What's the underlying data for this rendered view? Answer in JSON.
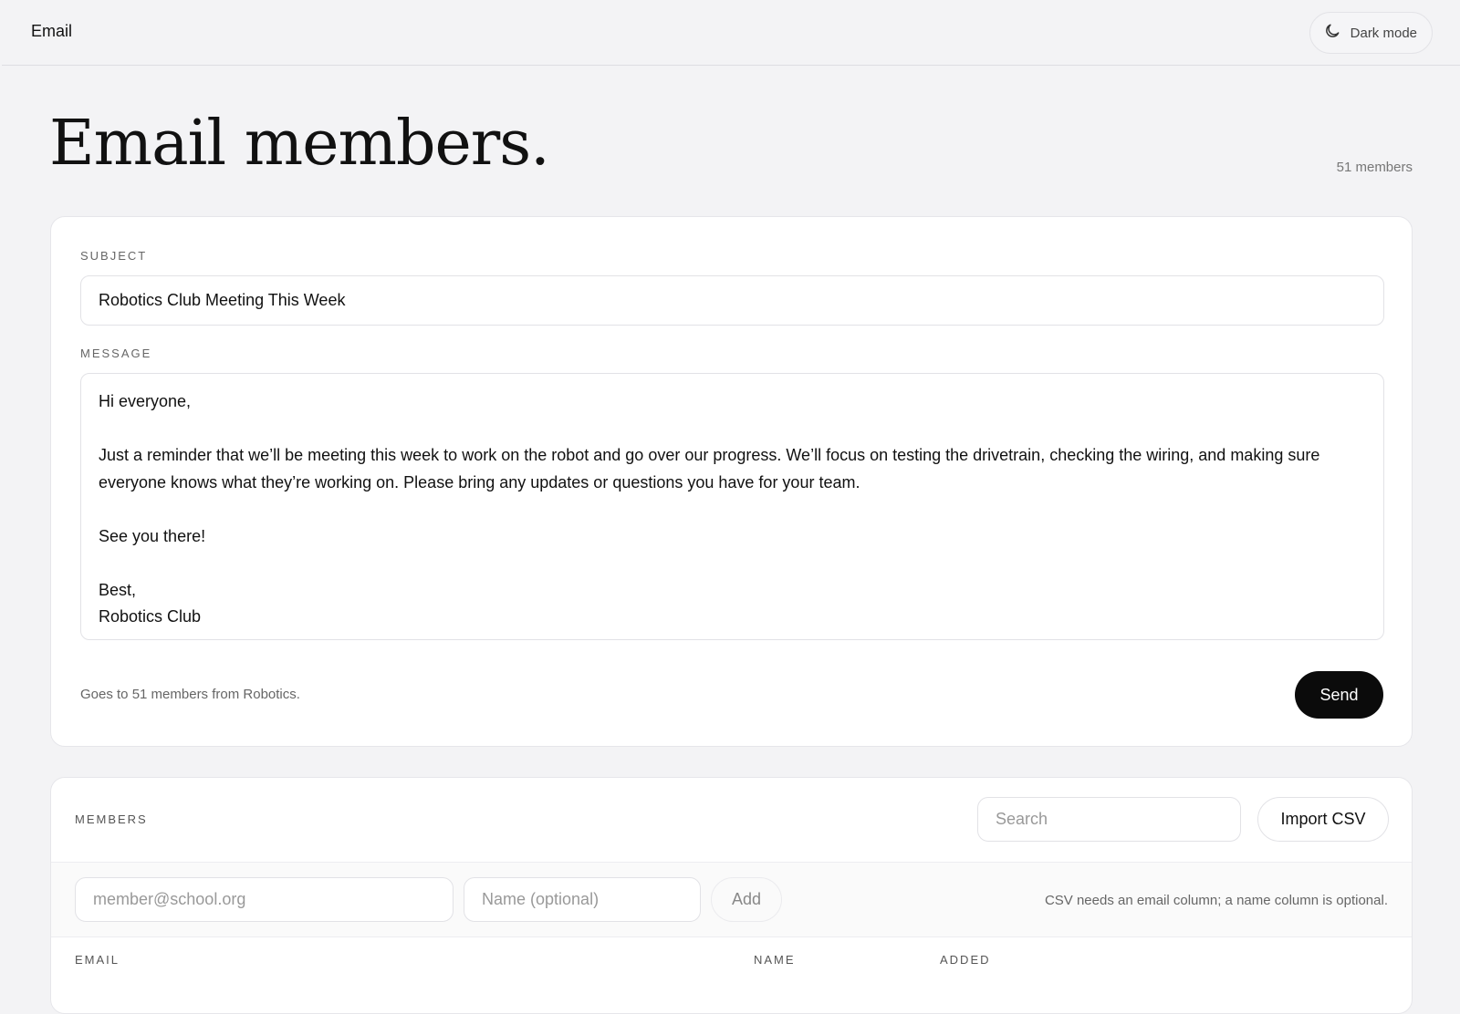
{
  "topbar": {
    "title": "Email",
    "dark_mode_label": "Dark mode",
    "dark_mode_icon": "moon-icon"
  },
  "page": {
    "title": "Email members.",
    "member_count": "51 members"
  },
  "compose": {
    "subject_label": "SUBJECT",
    "subject_value": "Robotics Club Meeting This Week",
    "message_label": "MESSAGE",
    "message_value": "Hi everyone,\n\nJust a reminder that we’ll be meeting this week to work on the robot and go over our progress. We’ll focus on testing the drivetrain, checking the wiring, and making sure everyone knows what they’re working on. Please bring any updates or questions you have for your team.\n\nSee you there!\n\nBest,\nRobotics Club",
    "recipients_note": "Goes to 51 members from Robotics.",
    "send_label": "Send"
  },
  "members": {
    "section_label": "MEMBERS",
    "search_placeholder": "Search",
    "import_label": "Import CSV",
    "email_placeholder": "member@school.org",
    "name_placeholder": "Name (optional)",
    "add_label": "Add",
    "csv_hint": "CSV needs an email column; a name column is optional.",
    "columns": [
      "EMAIL",
      "NAME",
      "ADDED"
    ]
  }
}
